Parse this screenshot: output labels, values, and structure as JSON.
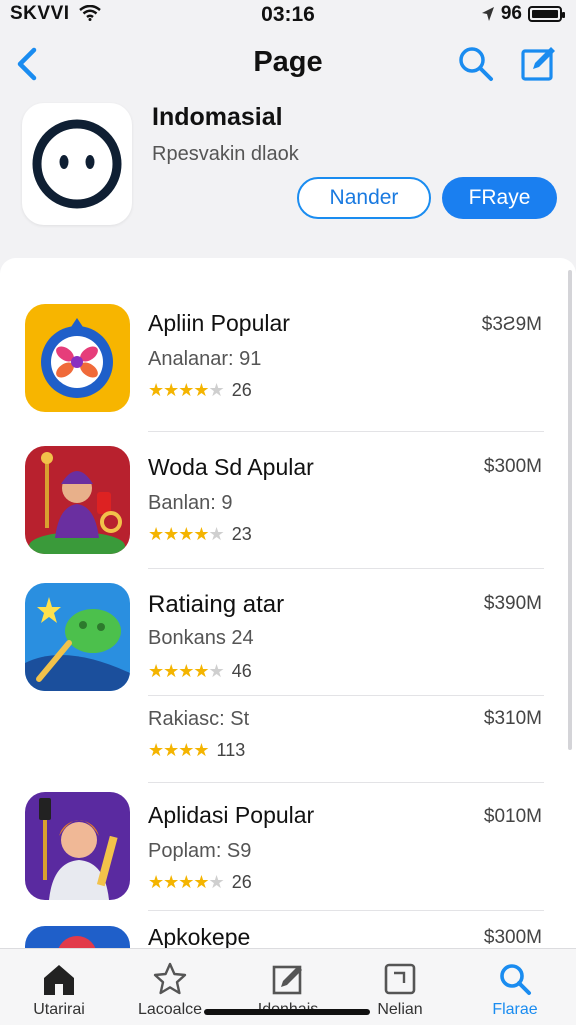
{
  "status_bar": {
    "carrier": "SKVVI",
    "time": "03:16",
    "battery_text": "96"
  },
  "nav": {
    "title": "Page",
    "back_icon": "chevron-left-icon",
    "search_icon": "search-icon",
    "compose_icon": "compose-icon"
  },
  "header": {
    "app_name": "Indomasial",
    "subtitle": "Rpesvakin dlaok",
    "outline_button": "Nander",
    "primary_button": "FRaye"
  },
  "list": {
    "items": [
      {
        "title": "Apliin Popular",
        "subtitle": "Analanar: 91",
        "rating_count": "26",
        "price": "$3Ƨ9M",
        "stars": 4
      },
      {
        "title": "Woda Sd Apular",
        "subtitle": "Banlan: 9",
        "rating_count": "23",
        "price": "$300M",
        "stars": 4
      },
      {
        "title": "Ratiaing atar",
        "subtitle": "Bonkans 24",
        "rating_count": "46",
        "price": "$390M",
        "stars": 4
      },
      {
        "title": "",
        "subtitle": "Rakiasc: St",
        "rating_count": "113",
        "price": "$310M",
        "stars": 4
      },
      {
        "title": "Aplidasi Popular",
        "subtitle": "Poplam: S9",
        "rating_count": "26",
        "price": "$010M",
        "stars": 4
      },
      {
        "title": "Apkokepe",
        "subtitle": "",
        "rating_count": "",
        "price": "$300M",
        "stars": 0
      }
    ]
  },
  "tab_bar": {
    "tabs": [
      {
        "label": "Utarirai",
        "icon": "home-icon",
        "active": false
      },
      {
        "label": "Lacoalce",
        "icon": "star-icon",
        "active": false
      },
      {
        "label": "Idonhais",
        "icon": "edit-icon",
        "active": false
      },
      {
        "label": "Nelian",
        "icon": "square-icon",
        "active": false
      },
      {
        "label": "Flarae",
        "icon": "search-icon",
        "active": true
      }
    ]
  },
  "colors": {
    "accent": "#1a7ff0",
    "star": "#f4b400",
    "background": "#f2f2f4"
  }
}
